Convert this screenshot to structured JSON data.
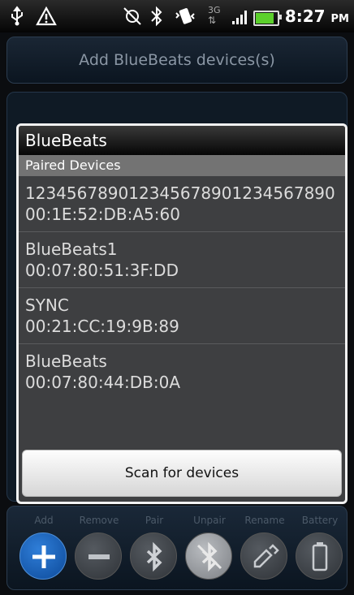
{
  "status_bar": {
    "time": "8:27",
    "ampm": "PM",
    "network_label": "3G",
    "icons": [
      "usb-icon",
      "warning-icon",
      "no-sync-icon",
      "bluetooth-icon",
      "vibrate-icon",
      "network-3g-icon",
      "signal-icon",
      "battery-icon"
    ],
    "battery_color": "#5cd02c"
  },
  "header": {
    "title": "Add BlueBeats devices(s)"
  },
  "dialog": {
    "title": "BlueBeats",
    "section_header": "Paired Devices",
    "devices": [
      {
        "name": "123456789012345678901234567890",
        "address": "00:1E:52:DB:A5:60"
      },
      {
        "name": "BlueBeats1",
        "address": "00:07:80:51:3F:DD"
      },
      {
        "name": "SYNC",
        "address": "00:21:CC:19:9B:89"
      },
      {
        "name": "BlueBeats",
        "address": "00:07:80:44:DB:0A"
      }
    ],
    "scan_button": "Scan for devices"
  },
  "toolbar": {
    "buttons": [
      {
        "label": "Add",
        "icon": "plus-icon",
        "active": true
      },
      {
        "label": "Remove",
        "icon": "minus-icon",
        "active": false
      },
      {
        "label": "Pair",
        "icon": "bluetooth-icon",
        "active": false
      },
      {
        "label": "Unpair",
        "icon": "bluetooth-off-icon",
        "active": false
      },
      {
        "label": "Rename",
        "icon": "edit-icon",
        "active": false
      },
      {
        "label": "Battery",
        "icon": "battery-icon",
        "active": false
      }
    ]
  },
  "colors": {
    "accent": "#2f7ed8",
    "dialog_bg": "#3e3f41",
    "section_header": "#737373"
  }
}
